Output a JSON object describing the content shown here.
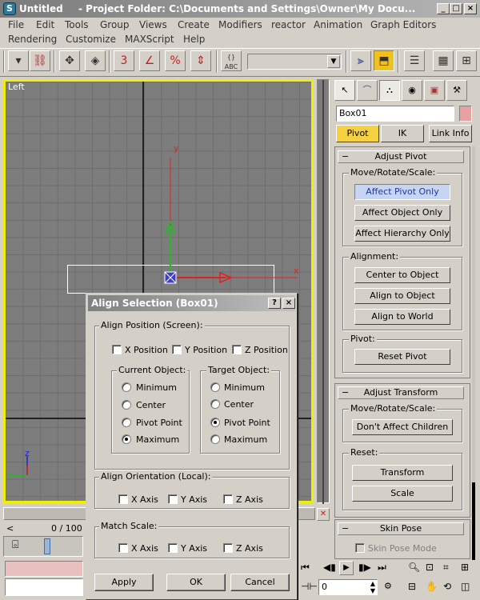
{
  "window": {
    "title_app": "Untitled",
    "title_sep": "- Project Folder: C:\\Documents and Settings\\Owner\\My Docu...",
    "min": "_",
    "max": "□",
    "close": "×"
  },
  "menu": {
    "row1": [
      "File",
      "Edit",
      "Tools",
      "Group",
      "Views",
      "Create",
      "Modifiers",
      "reactor",
      "Animation",
      "Graph Editors"
    ],
    "row2": [
      "Rendering",
      "Customize",
      "MAXScript",
      "Help"
    ]
  },
  "toolbar": {
    "dropdown_value": "",
    "icons": [
      "select-filter-icon",
      "select-link-icon",
      "unlink-icon",
      "bind-space-warp-icon",
      "snap-3d-icon",
      "angle-snap-icon",
      "percent-snap-icon",
      "spinner-snap-icon",
      "named-selection-icon",
      "mirror-icon",
      "align-icon",
      "layer-manager-icon",
      "curve-editor-icon",
      "schematic-icon"
    ],
    "snap_label": "3",
    "percent_label": "%",
    "abc_label": "ABC"
  },
  "viewport": {
    "label": "Left",
    "axis_y": "y",
    "axis_x": "x",
    "axis_z": "z"
  },
  "timeline": {
    "frame_label": "0 / 100",
    "spinner_value": "0"
  },
  "command_panel": {
    "tabs": [
      "create-icon",
      "modify-icon",
      "hierarchy-icon",
      "motion-icon",
      "display-icon",
      "utilities-icon"
    ],
    "object_name": "Box01",
    "color_swatch": "#e8a0a0",
    "sub_tabs": [
      "Pivot",
      "IK",
      "Link Info"
    ],
    "adjust_pivot": {
      "title": "Adjust Pivot",
      "move_group": "Move/Rotate/Scale:",
      "move_buttons": [
        "Affect Pivot Only",
        "Affect Object Only",
        "Affect Hierarchy Only"
      ],
      "alignment_group": "Alignment:",
      "alignment_buttons": [
        "Center to Object",
        "Align to Object",
        "Align to World"
      ],
      "pivot_group": "Pivot:",
      "reset_pivot": "Reset Pivot"
    },
    "adjust_transform": {
      "title": "Adjust Transform",
      "move_group": "Move/Rotate/Scale:",
      "dont_affect": "Don't Affect Children",
      "reset_group": "Reset:",
      "transform": "Transform",
      "scale": "Scale"
    },
    "skin_pose": {
      "title": "Skin Pose",
      "mode": "Skin Pose Mode"
    }
  },
  "dialog": {
    "title": "Align Selection (Box01)",
    "help": "?",
    "close": "×",
    "align_position": "Align Position (Screen):",
    "x_position": "X Position",
    "y_position": "Y Position",
    "z_position": "Z Position",
    "current_object": "Current Object:",
    "target_object": "Target Object:",
    "current_options": [
      "Minimum",
      "Center",
      "Pivot Point",
      "Maximum"
    ],
    "current_selected": 3,
    "target_options": [
      "Minimum",
      "Center",
      "Pivot Point",
      "Maximum"
    ],
    "target_selected": 2,
    "align_orientation": "Align Orientation (Local):",
    "orient_axes": [
      "X Axis",
      "Y Axis",
      "Z Axis"
    ],
    "match_scale": "Match Scale:",
    "scale_axes": [
      "X Axis",
      "Y Axis",
      "Z Axis"
    ],
    "apply": "Apply",
    "ok": "OK",
    "cancel": "Cancel"
  },
  "colors": {
    "viewport_border": "#f0f000",
    "axis_red": "#dd2222",
    "axis_green": "#22bb22",
    "axis_blue": "#2222dd",
    "active_button": "#c8d4f4",
    "pivot_tab": "#f5d040"
  }
}
